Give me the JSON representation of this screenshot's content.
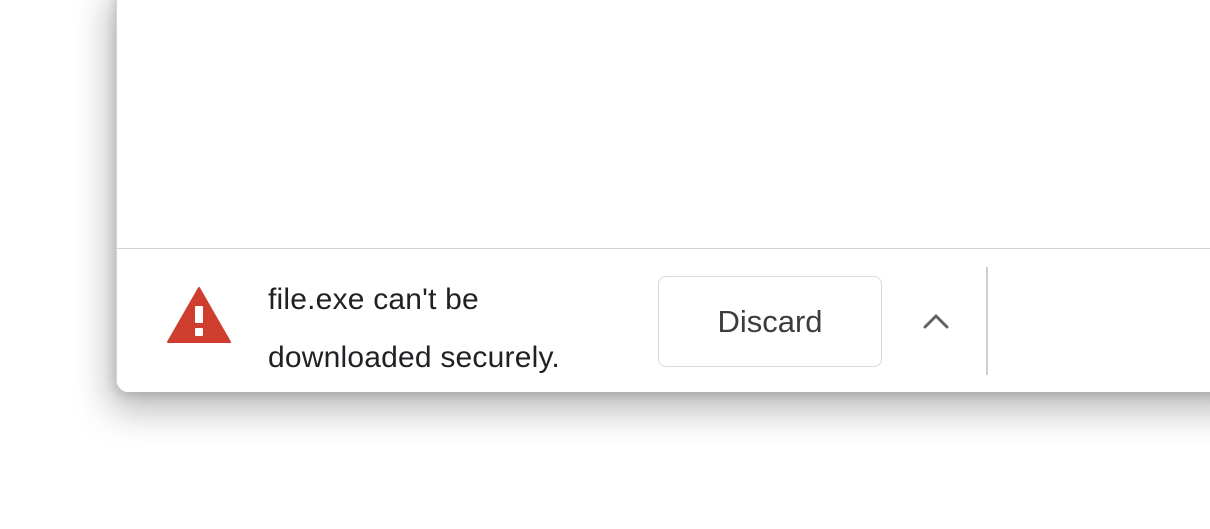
{
  "download_shelf": {
    "warning_icon": "warning-triangle-icon",
    "message_line1": "file.exe can't be",
    "message_line2": "downloaded securely.",
    "discard_label": "Discard",
    "expand_icon": "chevron-up-icon"
  },
  "colors": {
    "warning": "#cf3d2e",
    "text": "#202124",
    "button_text": "#3c3c3c",
    "border": "#d9d9d9"
  }
}
